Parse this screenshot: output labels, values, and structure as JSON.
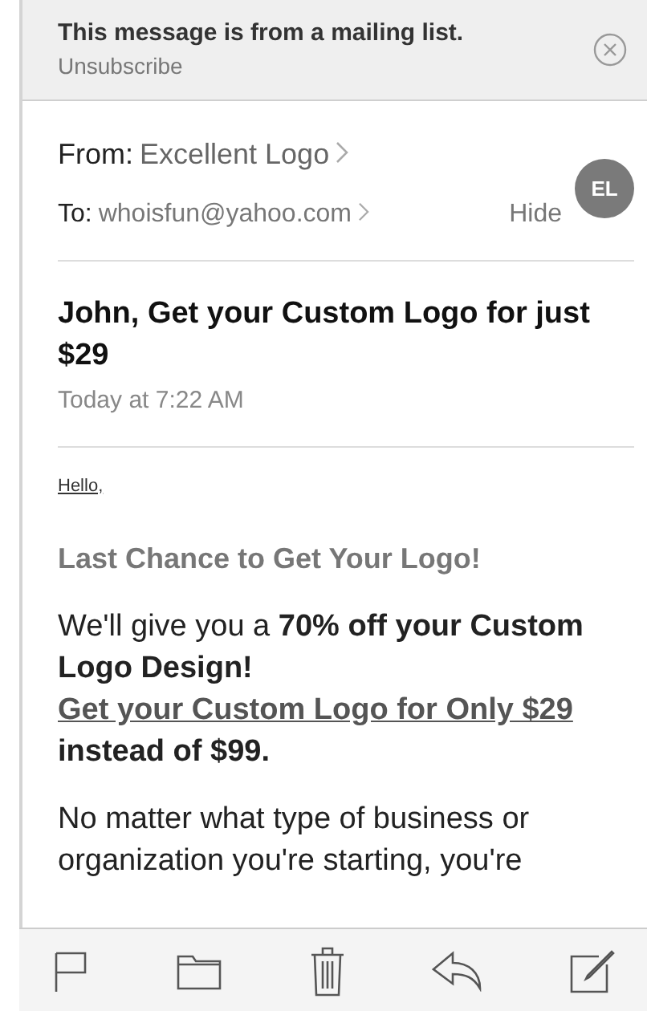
{
  "banner": {
    "text": "This message is from a mailing list.",
    "link": "Unsubscribe"
  },
  "header": {
    "from_label": "From:",
    "from_name": "Excellent Logo",
    "to_label": "To:",
    "to_address": "whoisfun@yahoo.com",
    "hide": "Hide",
    "avatar": "EL"
  },
  "subject": "John, Get your Custom Logo for just $29",
  "date": "Today at 7:22 AM",
  "body": {
    "greeting": "Hello,",
    "heading": "Last Chance to Get Your Logo!",
    "paragraphs": [
      [
        {
          "kind": "text",
          "text": "We'll give you a **70% off your Custom Logo Design!** "
        },
        {
          "kind": "link",
          "text": "Get your Custom Logo for Only $29"
        },
        {
          "kind": "text",
          "text": " **instead of $99.**"
        }
      ],
      [
        {
          "kind": "text",
          "text": "No matter what type of business or organization you're starting, you're"
        }
      ]
    ]
  }
}
